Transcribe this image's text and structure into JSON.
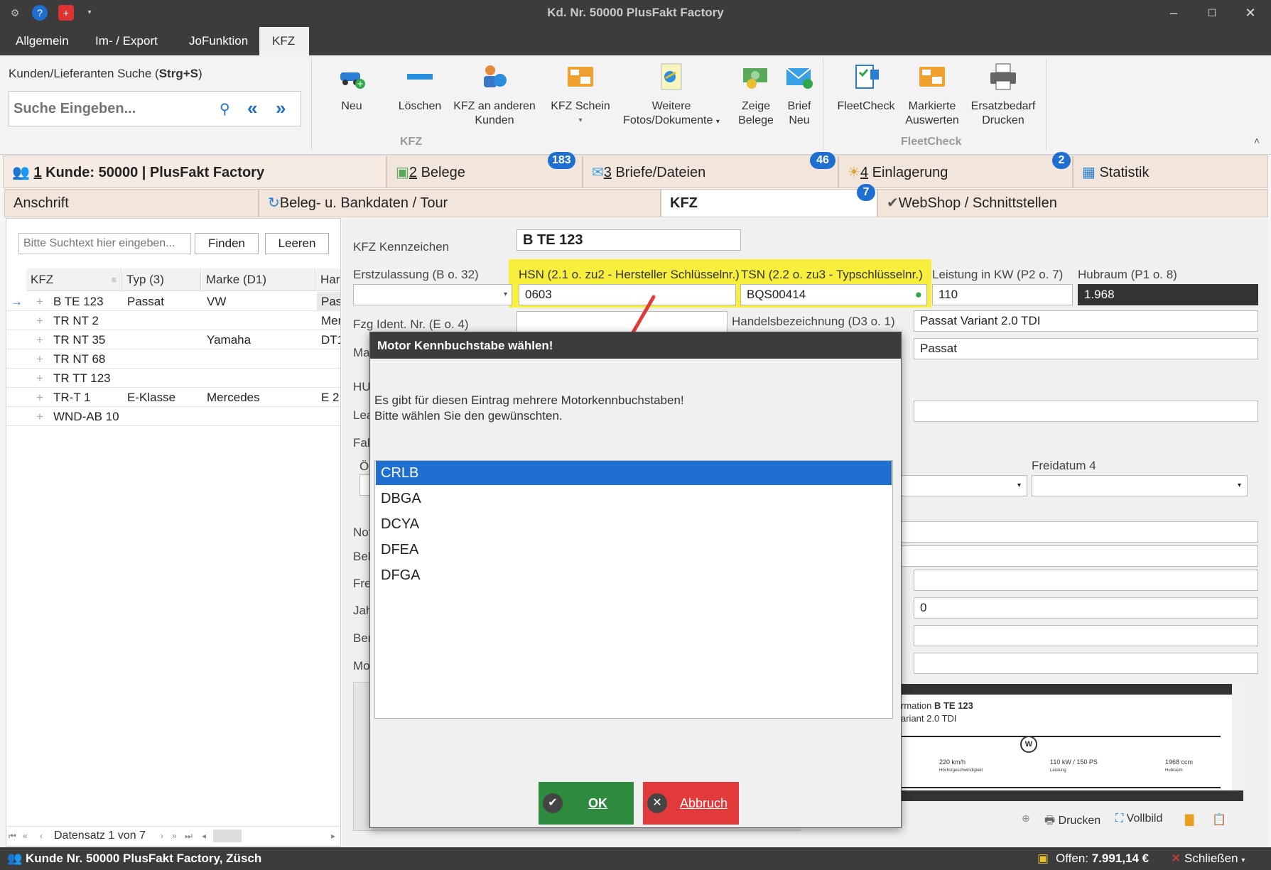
{
  "window": {
    "title": "Kd. Nr. 50000 PlusFakt Factory"
  },
  "menu": {
    "tabs": [
      "Allgemein",
      "Im- / Export",
      "JoFunktion",
      "KFZ"
    ]
  },
  "ribbon": {
    "search_label": "Kunden/Lieferanten Suche (",
    "search_shortcut": "Strg+S",
    "search_label_end": ")",
    "search_placeholder": "Suche Eingeben...",
    "buttons": {
      "neu": "Neu",
      "loeschen": "Löschen",
      "kfz_andere_1": "KFZ an anderen",
      "kfz_andere_2": "Kunden",
      "kfz_schein": "KFZ Schein",
      "weitere_1": "Weitere",
      "weitere_2": "Fotos/Dokumente",
      "zeige_1": "Zeige",
      "zeige_2": "Belege",
      "brief_1": "Brief",
      "brief_2": "Neu",
      "fleetcheck": "FleetCheck",
      "markierte_1": "Markierte",
      "markierte_2": "Auswerten",
      "ersatz_1": "Ersatzbedarf",
      "ersatz_2": "Drucken"
    },
    "group_kfz": "KFZ",
    "group_fleet": "FleetCheck"
  },
  "main_tabs": {
    "kunde_num": "1",
    "kunde": " Kunde: 50000",
    "kunde_name": "PlusFakt Factory",
    "belege_num": "2",
    "belege": " Belege",
    "belege_badge": "183",
    "briefe_num": "3",
    "briefe": " Briefe/Dateien",
    "briefe_badge": "46",
    "einlagerung_num": "4",
    "einlagerung": " Einlagerung",
    "einlagerung_badge": "2",
    "statistik": "Statistik"
  },
  "sub_tabs": {
    "anschrift": "Anschrift",
    "beleg": "Beleg- u. Bankdaten / Tour",
    "kfz": "KFZ",
    "kfz_badge": "7",
    "webshop": "WebShop / Schnittstellen"
  },
  "left": {
    "search_placeholder": "Bitte Suchtext hier eingeben...",
    "find": "Finden",
    "clear": "Leeren",
    "columns": [
      "KFZ",
      "Typ (3)",
      "Marke (D1)",
      "Har"
    ],
    "rows": [
      {
        "kfz": "B TE 123",
        "typ": "Passat",
        "marke": "VW",
        "har": "Pas"
      },
      {
        "kfz": "TR NT 2",
        "typ": "",
        "marke": "",
        "har": "Mer"
      },
      {
        "kfz": "TR NT 35",
        "typ": "",
        "marke": "Yamaha",
        "har": "DT1"
      },
      {
        "kfz": "TR NT 68",
        "typ": "",
        "marke": "",
        "har": ""
      },
      {
        "kfz": "TR TT 123",
        "typ": "",
        "marke": "",
        "har": ""
      },
      {
        "kfz": "TR-T 1",
        "typ": "E-Klasse",
        "marke": "Mercedes",
        "har": "E 2!"
      },
      {
        "kfz": "WND-AB 10",
        "typ": "",
        "marke": "",
        "har": ""
      }
    ],
    "nav_text": "Datensatz 1 von 7"
  },
  "form": {
    "kennzeichen_label": "KFZ Kennzeichen",
    "kennzeichen": "B TE 123",
    "erstzulassung_label": "Erstzulassung (B o. 32)",
    "hsn_label": "HSN (2.1 o. zu2 - Hersteller Schlüsselnr.)",
    "hsn": "0603",
    "tsn_label": "TSN (2.2 o. zu3 - Typschlüsselnr.)",
    "tsn": "BQS00414",
    "leistung_label": "Leistung in KW (P2 o. 7)",
    "leistung": "110",
    "hubraum_label": "Hubraum (P1 o. 8)",
    "hubraum": "1.968",
    "fzg_label": "Fzg Ident. Nr. (E o. 4)",
    "handels_label": "Handelsbezeichnung (D3 o. 1)",
    "handels": "Passat Variant 2.0 TDI",
    "typ_value": "Passat",
    "freidatum4_label": "Freidatum 4",
    "zero_value": "0",
    "partial_labels": [
      "Ma",
      "HU",
      "Lea",
      "Fal",
      "Ö",
      "Not",
      "Bel",
      "Fre",
      "Jah",
      "Ber",
      "Mo"
    ]
  },
  "preview": {
    "line1a": "rmation ",
    "line1b": "B TE 123",
    "line2": "ariant 2.0 TDI",
    "spec1": "220 km/h",
    "spec1_sub": "Höchstgeschwindigkeit",
    "spec2": "110 kW / 150 PS",
    "spec2_sub": "Leistung",
    "spec3": "1968 ccm",
    "spec3_sub": "Hubraum",
    "print": "Drucken",
    "fullscreen": "Vollbild"
  },
  "dialog": {
    "title": "Motor Kennbuchstabe wählen!",
    "message1": "Es gibt für diesen Eintrag mehrere Motorkennbuchstaben!",
    "message2": "Bitte wählen Sie den gewünschten.",
    "options": [
      "CRLB",
      "DBGA",
      "DCYA",
      "DFEA",
      "DFGA"
    ],
    "ok": "OK",
    "cancel": "Abbruch"
  },
  "status": {
    "left": "Kunde Nr. 50000 PlusFakt Factory, Züsch",
    "open_label": "Offen: ",
    "open_value": "7.991,14 €",
    "close": "Schließen"
  },
  "colors": {
    "accent": "#1f6fd1",
    "highlight": "#f7ef3c",
    "ok": "#2e8b3e",
    "cancel": "#e23a3a",
    "titlebar": "#3c3c3c"
  }
}
